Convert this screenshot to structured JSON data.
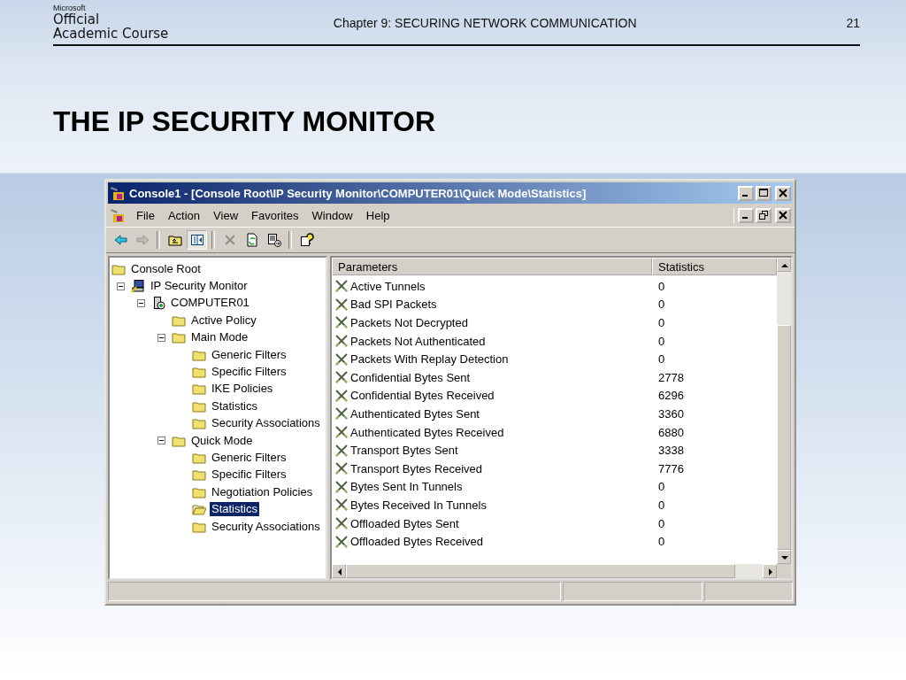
{
  "slide_header": {
    "logo": {
      "brand": "Microsoft",
      "line_1": "Official",
      "line_2": "Academic Course"
    },
    "chapter": "Chapter 9: SECURING NETWORK COMMUNICATION",
    "page_number": "21"
  },
  "slide_title": "THE IP SECURITY MONITOR",
  "window": {
    "title": "Console1 - [Console Root\\IP Security Monitor\\COMPUTER01\\Quick Mode\\Statistics]",
    "menu": [
      "File",
      "Action",
      "View",
      "Favorites",
      "Window",
      "Help"
    ],
    "toolbar": [
      [
        {
          "kind": "back",
          "disabled": false,
          "pressed": false
        },
        {
          "kind": "forward",
          "disabled": true,
          "pressed": false
        }
      ],
      [
        {
          "kind": "up",
          "disabled": false,
          "pressed": false
        },
        {
          "kind": "tree",
          "disabled": false,
          "pressed": true
        }
      ],
      [
        {
          "kind": "delete",
          "disabled": true,
          "pressed": false
        },
        {
          "kind": "refresh",
          "disabled": false,
          "pressed": false
        },
        {
          "kind": "export",
          "disabled": false,
          "pressed": false
        }
      ],
      [
        {
          "kind": "help",
          "disabled": false,
          "pressed": false
        }
      ]
    ],
    "tree": [
      {
        "label": "Console Root",
        "kind": "folder",
        "selected": false,
        "children": [
          {
            "label": "IP Security Monitor",
            "kind": "monitor",
            "selected": false,
            "expanded": true,
            "children": [
              {
                "label": "COMPUTER01",
                "kind": "server",
                "selected": false,
                "expanded": true,
                "children": [
                  {
                    "label": "Active Policy",
                    "kind": "folder",
                    "selected": false
                  },
                  {
                    "label": "Main Mode",
                    "kind": "folder",
                    "selected": false,
                    "expanded": true,
                    "children": [
                      {
                        "label": "Generic Filters",
                        "kind": "folder",
                        "selected": false
                      },
                      {
                        "label": "Specific Filters",
                        "kind": "folder",
                        "selected": false
                      },
                      {
                        "label": "IKE Policies",
                        "kind": "folder",
                        "selected": false
                      },
                      {
                        "label": "Statistics",
                        "kind": "folder",
                        "selected": false
                      },
                      {
                        "label": "Security Associations",
                        "kind": "folder",
                        "selected": false
                      }
                    ]
                  },
                  {
                    "label": "Quick Mode",
                    "kind": "folder",
                    "selected": false,
                    "expanded": true,
                    "children": [
                      {
                        "label": "Generic Filters",
                        "kind": "folder",
                        "selected": false
                      },
                      {
                        "label": "Specific Filters",
                        "kind": "folder",
                        "selected": false
                      },
                      {
                        "label": "Negotiation Policies",
                        "kind": "folder",
                        "selected": false
                      },
                      {
                        "label": "Statistics",
                        "kind": "folder",
                        "selected": true
                      },
                      {
                        "label": "Security Associations",
                        "kind": "folder",
                        "selected": false
                      }
                    ]
                  }
                ]
              }
            ]
          }
        ]
      }
    ],
    "table": {
      "columns": [
        "Parameters",
        "Statistics"
      ],
      "rows": [
        {
          "parameter": "Active Tunnels",
          "value": "0"
        },
        {
          "parameter": "Bad SPI Packets",
          "value": "0"
        },
        {
          "parameter": "Packets Not Decrypted",
          "value": "0"
        },
        {
          "parameter": "Packets Not Authenticated",
          "value": "0"
        },
        {
          "parameter": "Packets With Replay Detection",
          "value": "0"
        },
        {
          "parameter": "Confidential Bytes Sent",
          "value": "2778"
        },
        {
          "parameter": "Confidential Bytes Received",
          "value": "6296"
        },
        {
          "parameter": "Authenticated Bytes Sent",
          "value": "3360"
        },
        {
          "parameter": "Authenticated Bytes Received",
          "value": "6880"
        },
        {
          "parameter": "Transport Bytes Sent",
          "value": "3338"
        },
        {
          "parameter": "Transport Bytes Received",
          "value": "7776"
        },
        {
          "parameter": "Bytes Sent In Tunnels",
          "value": "0"
        },
        {
          "parameter": "Bytes Received In Tunnels",
          "value": "0"
        },
        {
          "parameter": "Offloaded Bytes Sent",
          "value": "0"
        },
        {
          "parameter": "Offloaded Bytes Received",
          "value": "0"
        }
      ]
    }
  }
}
